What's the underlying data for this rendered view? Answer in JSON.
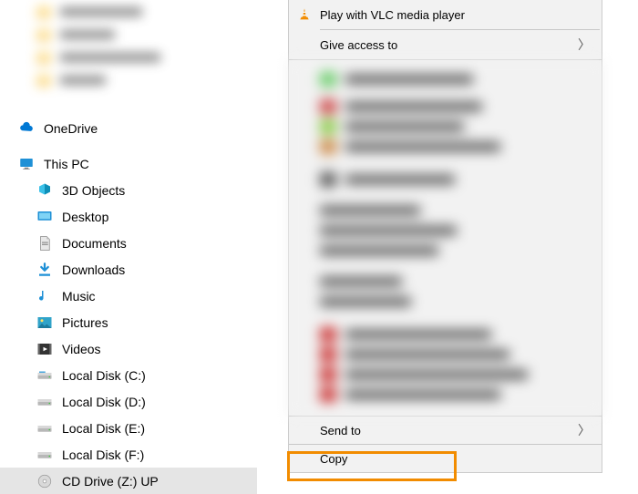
{
  "sidebar": {
    "onedrive": "OneDrive",
    "thispc": "This PC",
    "items": [
      {
        "label": "3D Objects"
      },
      {
        "label": "Desktop"
      },
      {
        "label": "Documents"
      },
      {
        "label": "Downloads"
      },
      {
        "label": "Music"
      },
      {
        "label": "Pictures"
      },
      {
        "label": "Videos"
      },
      {
        "label": "Local Disk (C:)"
      },
      {
        "label": "Local Disk (D:)"
      },
      {
        "label": "Local Disk (E:)"
      },
      {
        "label": "Local Disk (F:)"
      },
      {
        "label": "CD Drive (Z:) UP"
      }
    ]
  },
  "contextMenu": {
    "playVlc": "Play with VLC media player",
    "giveAccess": "Give access to",
    "sendTo": "Send to",
    "copy": "Copy"
  }
}
